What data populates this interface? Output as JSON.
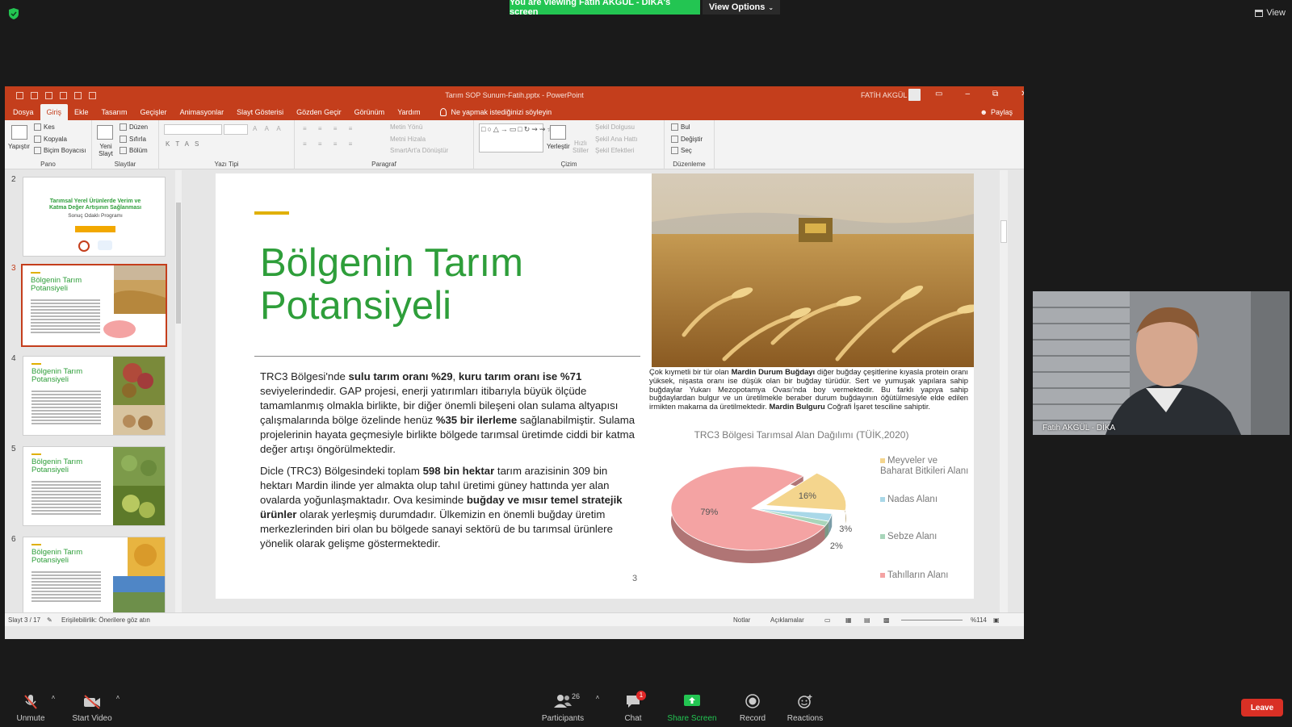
{
  "zoom_top": {
    "banner": "You are viewing Fatih AKGÜL - DİKA's screen",
    "view_options": "View Options",
    "view": "View"
  },
  "ppt": {
    "window_title": "Tarım SOP Sunum-Fatih.pptx  -  PowerPoint",
    "user": "FATİH AKGÜL",
    "tabs": [
      "Dosya",
      "Giriş",
      "Ekle",
      "Tasarım",
      "Geçişler",
      "Animasyonlar",
      "Slayt Gösterisi",
      "Gözden Geçir",
      "Görünüm",
      "Yardım"
    ],
    "active_tab": "Giriş",
    "tell_me": "Ne yapmak istediğinizi söyleyin",
    "share": "Paylaş",
    "ribbon": {
      "pano": {
        "label": "Pano",
        "paste": "Yapıştır",
        "cut": "Kes",
        "copy": "Kopyala",
        "format_painter": "Biçim Boyacısı"
      },
      "slaytlar": {
        "label": "Slaytlar",
        "new_slide": "Yeni Slayt",
        "layout": "Düzen",
        "reset": "Sıfırla",
        "section": "Bölüm"
      },
      "yazi_tipi": {
        "label": "Yazı Tipi"
      },
      "paragraf": {
        "label": "Paragraf",
        "text_direction": "Metin Yönü",
        "align_text": "Metni Hizala",
        "smartart": "SmartArt'a Dönüştür"
      },
      "cizim": {
        "label": "Çizim",
        "arrange": "Yerleştir",
        "quick_styles": "Hızlı Stiller",
        "shape_fill": "Şekil Dolgusu",
        "shape_outline": "Şekil Ana Hattı",
        "shape_effects": "Şekil Efektleri"
      },
      "duzenleme": {
        "label": "Düzenleme",
        "find": "Bul",
        "replace": "Değiştir",
        "select": "Seç"
      }
    },
    "thumbnails": [
      {
        "num": "2",
        "title": "Tarımsal Yerel Ürünlerde Verim ve Katma Değer Artışının Sağlanması",
        "subtitle": "Sonuç Odaklı Programı"
      },
      {
        "num": "3",
        "title": "Bölgenin Tarım Potansiyeli"
      },
      {
        "num": "4",
        "title": "Bölgenin Tarım Potansiyeli"
      },
      {
        "num": "5",
        "title": "Bölgenin Tarım Potansiyeli"
      },
      {
        "num": "6",
        "title": "Bölgenin Tarım Potansiyeli"
      }
    ],
    "slide": {
      "title": "Bölgenin Tarım Potansiyeli",
      "p1": {
        "a": "TRC3 Bölgesi'nde ",
        "b1": "sulu tarım oranı %29",
        "c": ", ",
        "b2": "kuru tarım oranı ise %71",
        "d": " seviyelerindedir. GAP projesi, enerji yatırımları itibarıyla büyük ölçüde tamamlanmış olmakla birlikte, bir diğer önemli bileşeni olan sulama altyapısı çalışmalarında bölge özelinde henüz ",
        "b3": "%35 bir ilerleme",
        "e": " sağlanabilmiştir. Sulama projelerinin hayata geçmesiyle birlikte bölgede tarımsal üretimde ciddi bir katma değer artışı öngörülmektedir."
      },
      "p2": {
        "a": "Dicle (TRC3) Bölgesindeki toplam ",
        "b1": "598 bin hektar",
        "c": " tarım arazisinin 309 bin hektarı Mardin ilinde yer almakta olup tahıl üretimi güney hattında yer alan ovalarda yoğunlaşmaktadır. Ova kesiminde ",
        "b2": "buğday ve mısır temel stratejik ürünler",
        "d": " olarak yerleşmiş durumdadır. Ülkemizin en önemli buğday üretim merkezlerinden biri olan bu bölgede sanayi sektörü de bu tarımsal ürünlere yönelik olarak gelişme göstermektedir."
      },
      "caption": {
        "a": "Çok kıymetli bir tür olan ",
        "b1": "Mardin Durum Buğdayı",
        "c": " diğer buğday çeşitlerine kıyasla protein oranı yüksek, nişasta oranı ise düşük olan bir buğday türüdür. Sert ve yumuşak yapılara sahip buğdaylar Yukarı Mezopotamya Ovası'nda boy vermektedir. Bu farklı yapıya sahip buğdaylardan bulgur ve un üretilmekle beraber durum buğdayının öğütülmesiyle elde edilen irmikten makarna da üretilmektedir. ",
        "b2": "Mardin Bulguru",
        "d": " Coğrafi İşaret tesciline sahiptir."
      },
      "slide_number": "3"
    },
    "status": {
      "slide_info": "Slayt 3 / 17",
      "accessibility": "Erişilebilirlik: Önerilere göz atın",
      "notes": "Notlar",
      "comments": "Açıklamalar",
      "zoom": "%114"
    }
  },
  "chart_data": {
    "type": "pie",
    "title": "TRC3 Bölgesi Tarımsal Alan Dağılımı (TÜİK,2020)",
    "categories": [
      "Meyveler ve Baharat Bitkileri Alanı",
      "Nadas Alanı",
      "Sebze Alanı",
      "Tahılların Alanı"
    ],
    "values": [
      16,
      3,
      2,
      79
    ],
    "value_labels": [
      "16%",
      "3%",
      "2%",
      "79%"
    ],
    "colors": [
      "#f4d58d",
      "#a9d8e8",
      "#a8d5ba",
      "#f4a3a3"
    ],
    "legend_position": "right",
    "exploded": "Meyveler ve Baharat Bitkileri Alanı",
    "three_d": true
  },
  "webcam": {
    "name": "Fatih AKGÜL - DİKA"
  },
  "zoom_bottom": {
    "unmute": "Unmute",
    "start_video": "Start Video",
    "participants": "Participants",
    "participants_count": "26",
    "chat": "Chat",
    "chat_badge": "1",
    "share_screen": "Share Screen",
    "record": "Record",
    "reactions": "Reactions",
    "leave": "Leave"
  }
}
